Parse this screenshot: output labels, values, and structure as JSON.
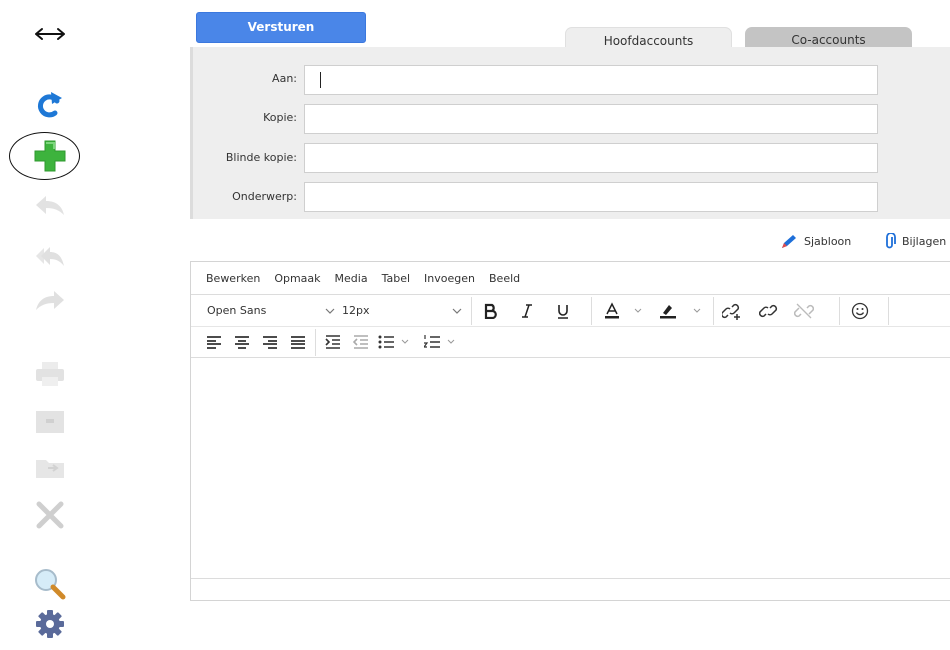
{
  "left_toolbar": {
    "icons": [
      "resize-horizontal-icon",
      "refresh-icon",
      "add-icon",
      "reply-icon",
      "reply-all-icon",
      "forward-icon",
      "print-icon",
      "archive-icon",
      "move-icon",
      "delete-icon",
      "search-icon",
      "settings-icon"
    ]
  },
  "actions": {
    "send_label": "Versturen"
  },
  "tabs": [
    {
      "label": "Hoofdaccounts",
      "active": true
    },
    {
      "label": "Co-accounts",
      "active": false
    }
  ],
  "header_fields": {
    "to_label": "Aan:",
    "to_value": "",
    "cc_label": "Kopie:",
    "cc_value": "",
    "bcc_label": "Blinde kopie:",
    "bcc_value": "",
    "subject_label": "Onderwerp:",
    "subject_value": ""
  },
  "links": {
    "template_label": "Sjabloon",
    "attachments_label": "Bijlagen"
  },
  "editor": {
    "menu": [
      "Bewerken",
      "Opmaak",
      "Media",
      "Tabel",
      "Invoegen",
      "Beeld"
    ],
    "font_family": "Open Sans",
    "font_size": "12px"
  },
  "colors": {
    "accent": "#4a86e8",
    "add_green": "#3db33d",
    "template_icon": "#1e6fd9",
    "panel_bg": "#eeeeee"
  }
}
